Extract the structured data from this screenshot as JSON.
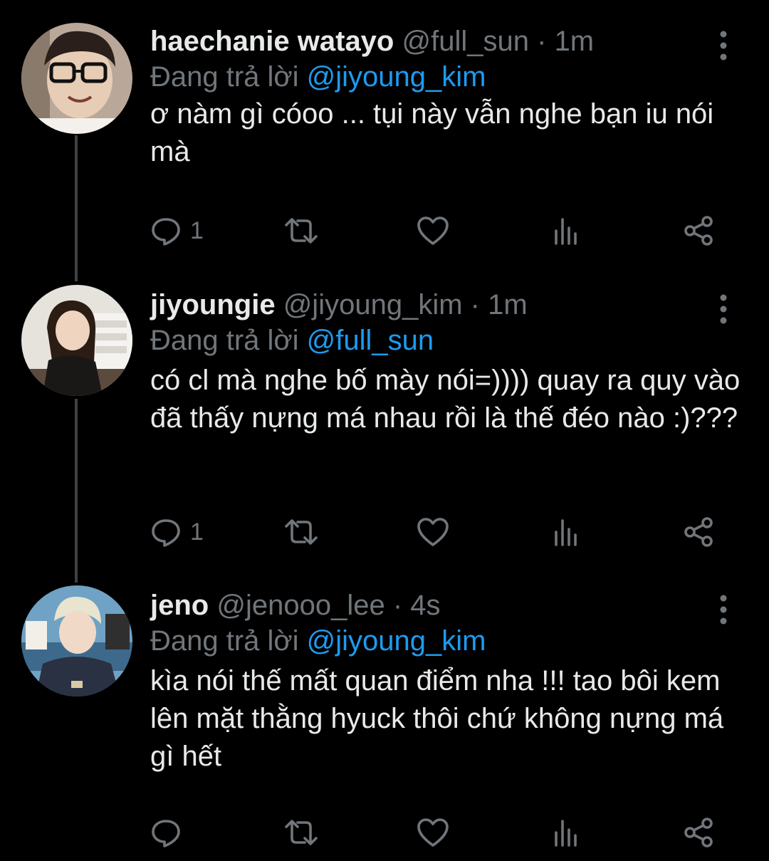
{
  "colors": {
    "background": "#000000",
    "primary_text": "#e7e9ea",
    "secondary_text": "#71767b",
    "accent": "#1d9bf0",
    "thread_line": "#3e4144"
  },
  "tweets": [
    {
      "display_name": "haechanie watayo",
      "handle": "@full_sun",
      "separator": "·",
      "time": "1m",
      "reply_prefix": "Đang trả lời",
      "reply_to": "@jiyoung_kim",
      "text": "ơ nàm gì cóoo ... tụi này vẫn nghe bạn iu nói mà",
      "reply_count": "1",
      "icons": [
        "more-icon",
        "reply-icon",
        "retweet-icon",
        "like-icon",
        "views-icon",
        "share-icon"
      ]
    },
    {
      "display_name": "jiyoungie",
      "handle": "@jiyoung_kim",
      "separator": "·",
      "time": "1m",
      "reply_prefix": "Đang trả lời",
      "reply_to": "@full_sun",
      "text": "có cl mà nghe bố mày nói=)))) quay ra quy vào đã thấy nựng má nhau rồi là thế đéo nào :)???",
      "reply_count": "1",
      "icons": [
        "more-icon",
        "reply-icon",
        "retweet-icon",
        "like-icon",
        "views-icon",
        "share-icon"
      ]
    },
    {
      "display_name": "jeno",
      "handle": "@jenooo_lee",
      "separator": "·",
      "time": "4s",
      "reply_prefix": "Đang trả lời",
      "reply_to": "@jiyoung_kim",
      "text": "kìa nói thế mất quan điểm nha !!! tao bôi kem lên mặt thằng hyuck thôi chứ không nựng má gì hết",
      "reply_count": "",
      "icons": [
        "more-icon",
        "reply-icon",
        "retweet-icon",
        "like-icon",
        "views-icon",
        "share-icon"
      ]
    }
  ]
}
